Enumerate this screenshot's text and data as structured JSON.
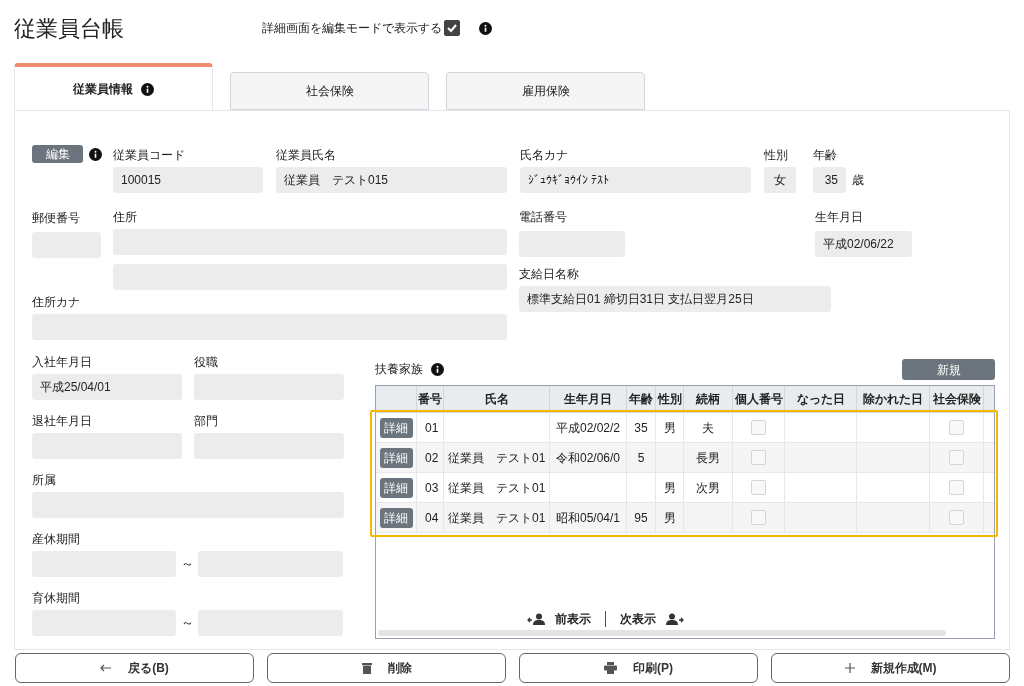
{
  "title": "従業員台帳",
  "edit_mode_option": {
    "label": "詳細画面を編集モードで表示する",
    "checked": true
  },
  "tabs": [
    {
      "label": "従業員情報",
      "selected": true,
      "info": true
    },
    {
      "label": "社会保険",
      "selected": false,
      "info": false
    },
    {
      "label": "雇用保険",
      "selected": false,
      "info": false
    }
  ],
  "edit_button": "編集",
  "fields": {
    "employee_code": {
      "label": "従業員コード",
      "value": "100015"
    },
    "employee_name": {
      "label": "従業員氏名",
      "value": "従業員　テスト015"
    },
    "name_kana": {
      "label": "氏名カナ",
      "value": "ｼﾞｭｳｷﾞｮｳｲﾝ ﾃｽﾄ"
    },
    "gender": {
      "label": "性別",
      "value": "女"
    },
    "age": {
      "label": "年齢",
      "value": "35",
      "unit": "歳"
    },
    "postal_code": {
      "label": "郵便番号"
    },
    "address": {
      "label": "住所"
    },
    "phone": {
      "label": "電話番号"
    },
    "birth_date": {
      "label": "生年月日",
      "value": "平成02/06/22"
    },
    "payday_name": {
      "label": "支給日名称",
      "value": "標準支給日01 締切日31日 支払日翌月25日"
    },
    "address_kana": {
      "label": "住所カナ"
    },
    "hire_date": {
      "label": "入社年月日",
      "value": "平成25/04/01"
    },
    "position": {
      "label": "役職"
    },
    "retire_date": {
      "label": "退社年月日"
    },
    "department": {
      "label": "部門"
    },
    "affiliation": {
      "label": "所属"
    },
    "maternity_leave": {
      "label": "産休期間",
      "separator": "～"
    },
    "childcare_leave": {
      "label": "育休期間",
      "separator": "～"
    }
  },
  "dependents": {
    "title": "扶養家族",
    "new_button": "新規",
    "highlight": true,
    "columns": [
      "番号",
      "氏名",
      "生年月日",
      "年齢",
      "性別",
      "続柄",
      "個人番号",
      "なった日",
      "除かれた日",
      "社会保険"
    ],
    "rows": [
      {
        "detail_button": "詳細",
        "number": "01",
        "birth_date": "平成02/02/2",
        "age": "35",
        "gender": "男",
        "relation": "夫",
        "my_number": false,
        "social_insurance": false
      },
      {
        "detail_button": "詳細",
        "number": "02",
        "name": "従業員　テスト01",
        "birth_date": "令和02/06/0",
        "age": "5",
        "relation": "長男",
        "my_number": false,
        "social_insurance": false
      },
      {
        "detail_button": "詳細",
        "number": "03",
        "name": "従業員　テスト01",
        "gender": "男",
        "relation": "次男",
        "my_number": false,
        "social_insurance": false
      },
      {
        "detail_button": "詳細",
        "number": "04",
        "name": "従業員　テスト01",
        "birth_date": "昭和05/04/1",
        "age": "95",
        "gender": "男",
        "my_number": false,
        "social_insurance": false
      }
    ],
    "pager": {
      "prev": "前表示",
      "next": "次表示"
    }
  },
  "footer_buttons": [
    {
      "kind": "back",
      "label": "戻る(B)"
    },
    {
      "kind": "delete",
      "label": "削除"
    },
    {
      "kind": "print",
      "label": "印刷(P)"
    },
    {
      "kind": "new",
      "label": "新規作成(M)"
    }
  ]
}
